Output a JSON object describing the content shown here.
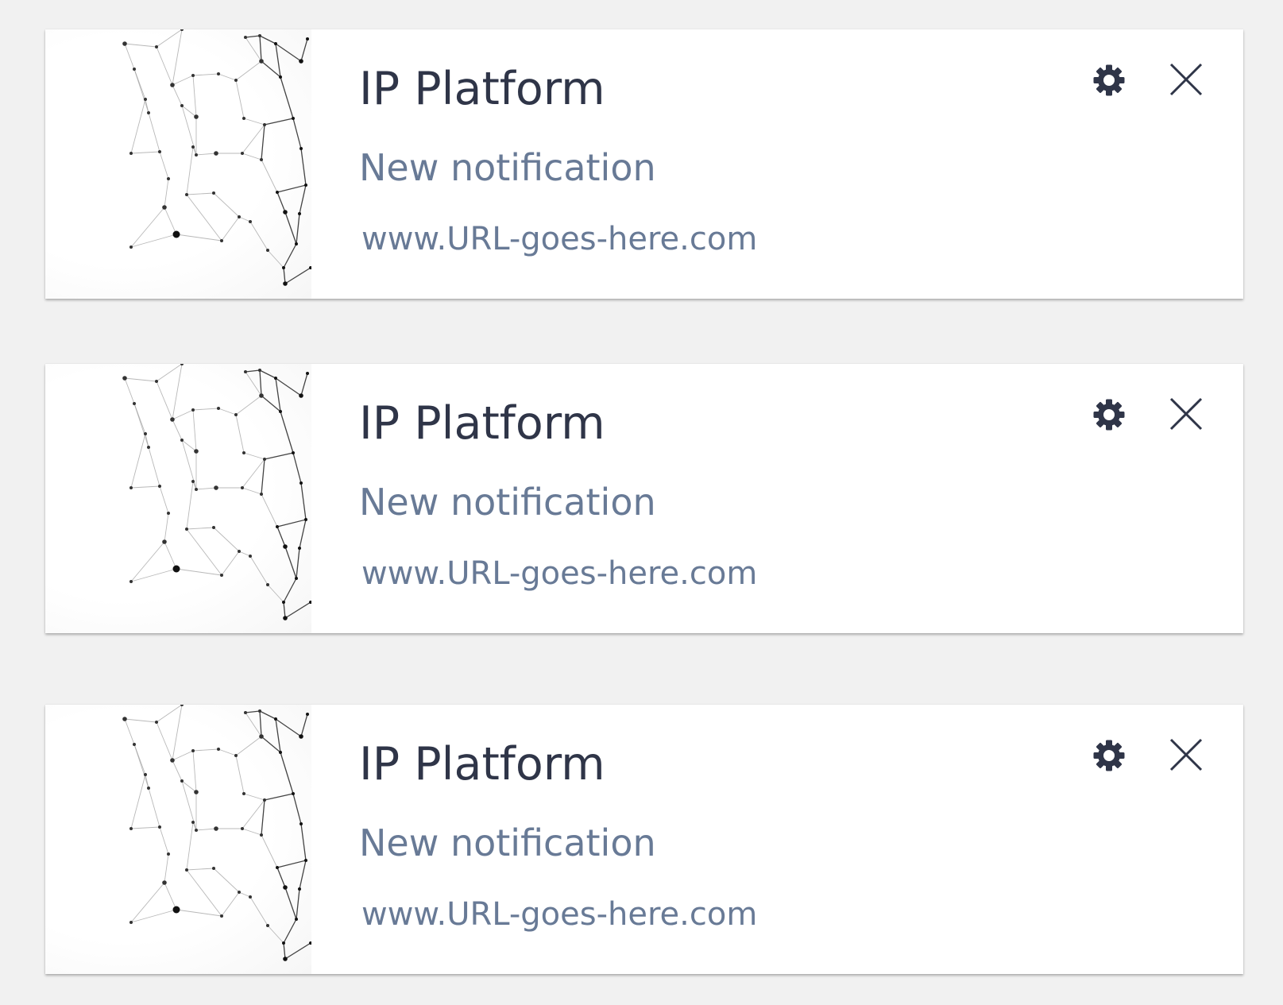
{
  "notifications": [
    {
      "title": "IP Platform",
      "message": "New notification",
      "url": "www.URL-goes-here.com",
      "thumbnail_icon": "network-graph-image",
      "settings_icon": "gear-icon",
      "close_icon": "close-icon"
    },
    {
      "title": "IP Platform",
      "message": "New notification",
      "url": "www.URL-goes-here.com",
      "thumbnail_icon": "network-graph-image",
      "settings_icon": "gear-icon",
      "close_icon": "close-icon"
    },
    {
      "title": "IP Platform",
      "message": "New notification",
      "url": "www.URL-goes-here.com",
      "thumbnail_icon": "network-graph-image",
      "settings_icon": "gear-icon",
      "close_icon": "close-icon"
    }
  ],
  "colors": {
    "page_background": "#f1f1f1",
    "card_background": "#ffffff",
    "title_text": "#2f3548",
    "secondary_text": "#687a96",
    "icon": "#2f3548"
  }
}
